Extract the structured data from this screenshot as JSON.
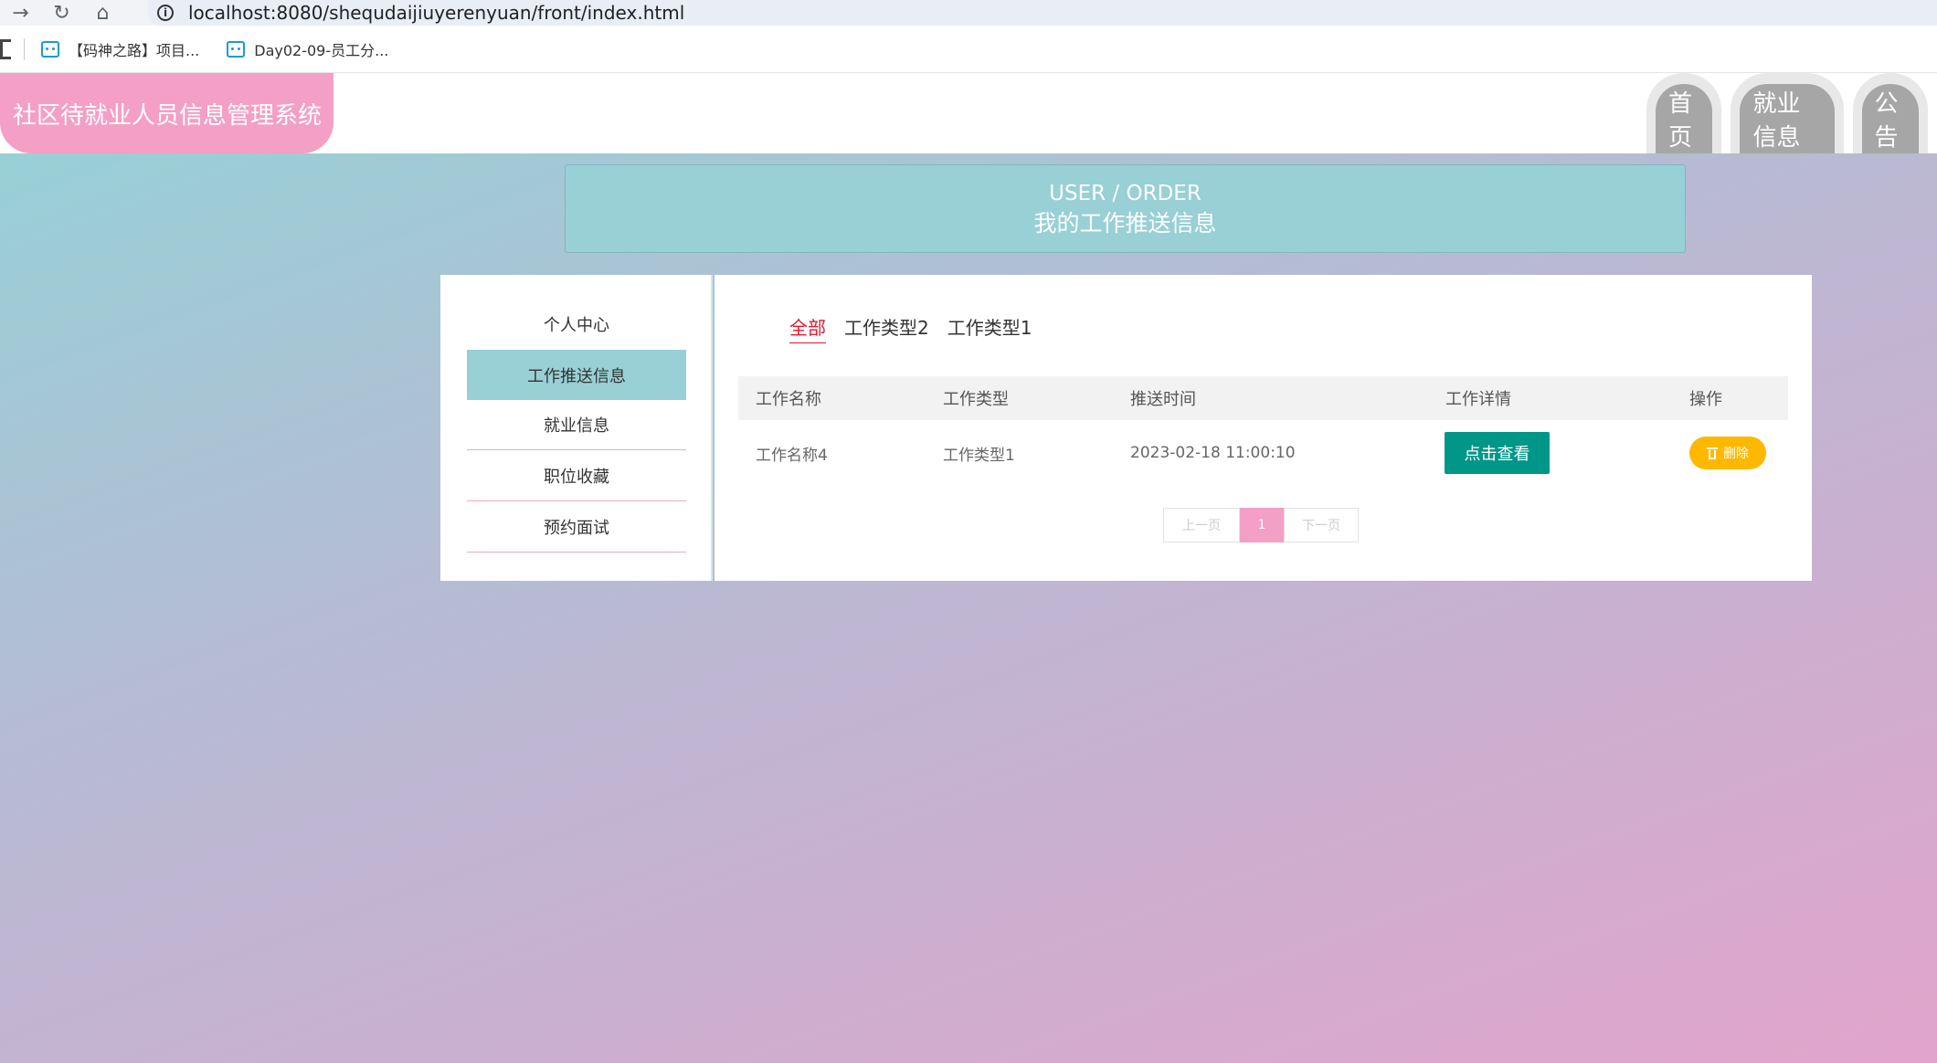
{
  "browser": {
    "url": "localhost:8080/shequdaijiuyerenyuan/front/index.html",
    "bookmarks": [
      "【码神之路】项目...",
      "Day02-09-员工分..."
    ]
  },
  "header": {
    "site_title": "社区待就业人员信息管理系统",
    "nav": [
      "首页",
      "就业信息",
      "公告"
    ]
  },
  "banner": {
    "en": "USER / ORDER",
    "cn": "我的工作推送信息"
  },
  "sidebar": {
    "items": [
      "个人中心",
      "工作推送信息",
      "就业信息",
      "职位收藏",
      "预约面试"
    ],
    "active_index": 1
  },
  "filters": {
    "tabs": [
      "全部",
      "工作类型2",
      "工作类型1"
    ],
    "active_index": 0
  },
  "table": {
    "columns": [
      "工作名称",
      "工作类型",
      "推送时间",
      "工作详情",
      "操作"
    ],
    "rows": [
      {
        "name": "工作名称4",
        "type": "工作类型1",
        "time": "2023-02-18 11:00:10",
        "detail_button": "点击查看",
        "delete_button": "删除"
      }
    ]
  },
  "pagination": {
    "prev": "上一页",
    "current": "1",
    "next": "下一页"
  },
  "colors": {
    "logo": "#f39fc6",
    "accent": "#98d0d6",
    "view_button": "#009688",
    "delete_button": "#ffb800",
    "active_filter": "#e0192c"
  }
}
